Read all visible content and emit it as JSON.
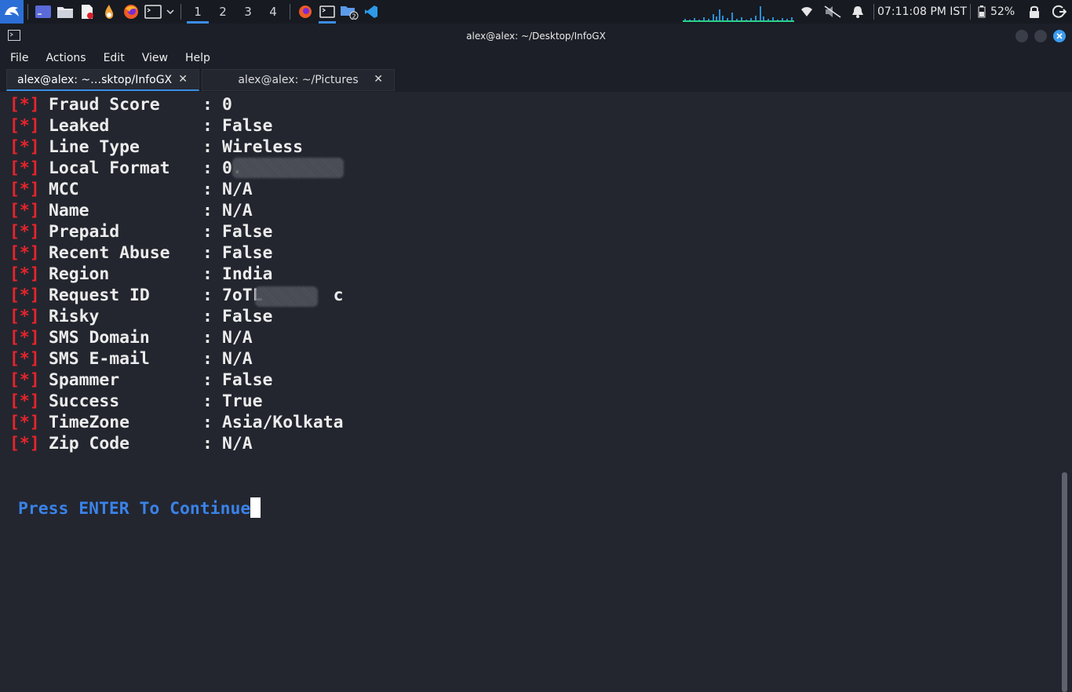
{
  "panel": {
    "workspaces": [
      "1",
      "2",
      "3",
      "4"
    ],
    "active_workspace": "1",
    "task_badge": "2",
    "clock": "07:11:08 PM IST",
    "battery": "52%"
  },
  "window": {
    "title": "alex@alex: ~/Desktop/InfoGX"
  },
  "menu": [
    "File",
    "Actions",
    "Edit",
    "View",
    "Help"
  ],
  "tabs": [
    {
      "label": "alex@alex: ~…sktop/InfoGX",
      "close": "✕"
    },
    {
      "label": "alex@alex: ~/Pictures",
      "close": "✕"
    }
  ],
  "terminal": {
    "marker": "[*]",
    "rows": [
      {
        "key": "Fraud Score",
        "value": "0"
      },
      {
        "key": "Leaked",
        "value": "False"
      },
      {
        "key": "Line Type",
        "value": "Wireless"
      },
      {
        "key": "Local Format",
        "value": "0."
      },
      {
        "key": "MCC",
        "value": "N/A"
      },
      {
        "key": "Name",
        "value": "N/A"
      },
      {
        "key": "Prepaid",
        "value": "False"
      },
      {
        "key": "Recent Abuse",
        "value": "False"
      },
      {
        "key": "Region",
        "value": "India"
      },
      {
        "key": "Request ID",
        "value": "7oTL       c"
      },
      {
        "key": "Risky",
        "value": "False"
      },
      {
        "key": "SMS Domain",
        "value": "N/A"
      },
      {
        "key": "SMS E-mail",
        "value": "N/A"
      },
      {
        "key": "Spammer",
        "value": "False"
      },
      {
        "key": "Success",
        "value": "True"
      },
      {
        "key": "TimeZone",
        "value": "Asia/Kolkata"
      },
      {
        "key": "Zip Code",
        "value": "N/A"
      }
    ],
    "prompt": "Press ENTER To Continue"
  },
  "colors": {
    "accent": "#3b8ee6",
    "marker": "#e8242b",
    "prompt": "#3a82e8",
    "background": "#23262f"
  }
}
